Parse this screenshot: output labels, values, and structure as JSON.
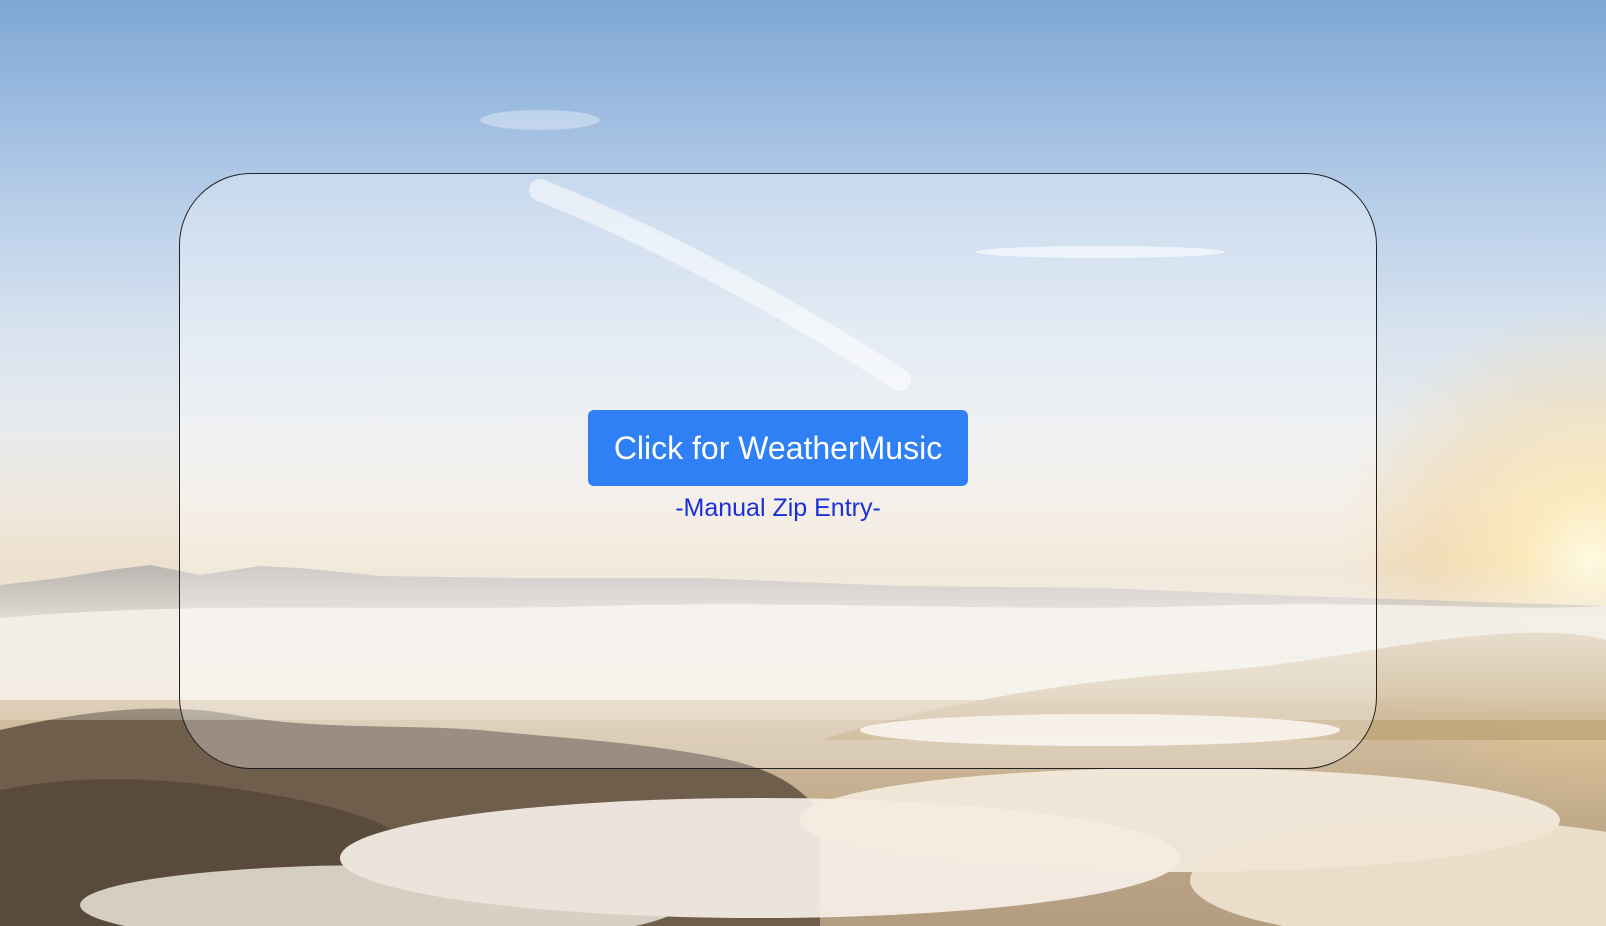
{
  "main": {
    "primary_button_label": "Click for WeatherMusic",
    "manual_entry_link": "-Manual Zip Entry-"
  },
  "colors": {
    "button_background": "#2f7ff5",
    "link_text": "#1a2fd8"
  }
}
